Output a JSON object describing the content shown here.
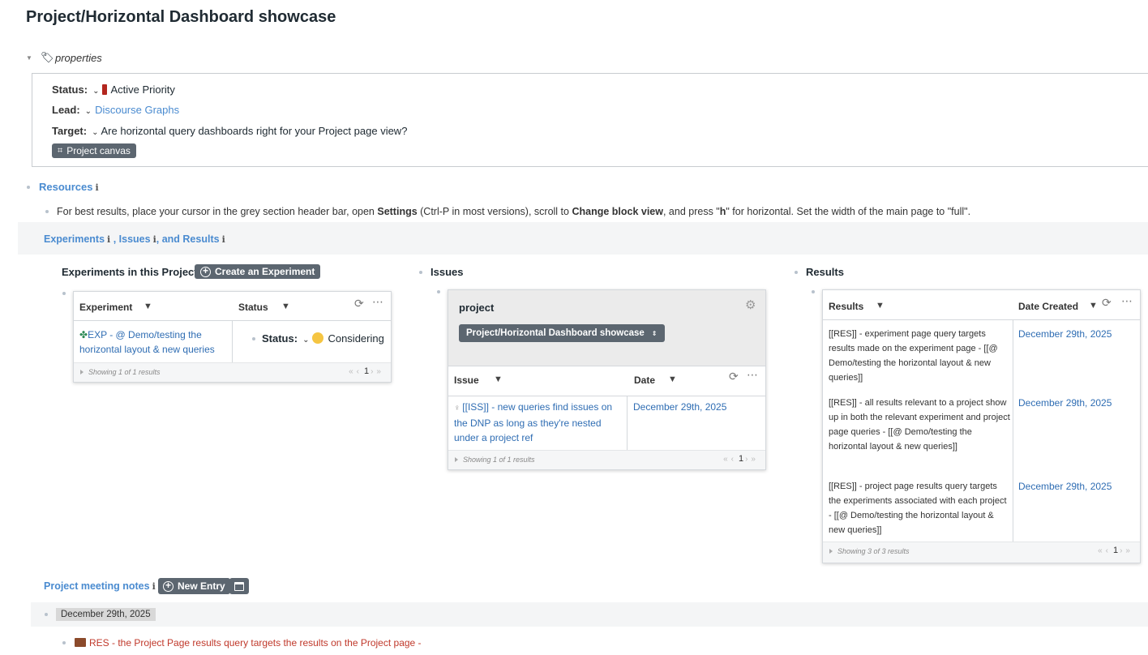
{
  "page": {
    "title": "Project/Horizontal Dashboard showcase"
  },
  "properties": {
    "label": "properties",
    "status_label": "Status:",
    "status_value": "Active Priority",
    "lead_label": "Lead:",
    "lead_value": "Discourse Graphs",
    "target_label": "Target:",
    "target_value": "Are horizontal query dashboards right for your Project page view?",
    "canvas_button": "Project canvas"
  },
  "resources": {
    "label": "Resources",
    "info": "i",
    "tip_prefix": "For best results, place your cursor in the grey section header bar, open ",
    "tip_settings": "Settings",
    "tip_mid": " (Ctrl-P in most versions), scroll to ",
    "tip_change": "Change block view",
    "tip_mid2": ", and press \"",
    "tip_h": "h",
    "tip_suffix": "\" for horizontal. Set the width of the main page to \"full\"."
  },
  "section_header": {
    "experiments": "Experiments",
    "sep1": " , ",
    "issues": "Issues",
    "sep2": ", ",
    "and_results": "and Results",
    "info": "i"
  },
  "experiments": {
    "title": "Experiments in this Project",
    "create_button": "Create an Experiment",
    "columns": [
      "Experiment",
      "Status"
    ],
    "rows": [
      {
        "experiment": "EXP - @ Demo/testing the horizontal layout & new queries",
        "status_label": "Status:",
        "status_value": "Considering"
      }
    ],
    "showing": "Showing 1 of 1 results",
    "page": "1"
  },
  "issues": {
    "title": "Issues",
    "panel_title": "project",
    "panel_select": "Project/Horizontal Dashboard showcase",
    "columns": [
      "Issue",
      "Date"
    ],
    "rows": [
      {
        "issue": "[[ISS]] - new queries find issues on the DNP as long as they're nested under a project ref",
        "date": "December 29th, 2025"
      }
    ],
    "showing": "Showing 1 of 1 results",
    "page": "1"
  },
  "results": {
    "title": "Results",
    "columns": [
      "Results",
      "Date Created"
    ],
    "rows": [
      {
        "result": "[[RES]] - experiment page query targets results made on the experiment page - [[@ Demo/testing the horizontal layout & new queries]]",
        "date": "December 29th, 2025"
      },
      {
        "result": "[[RES]] - all results relevant to a project show up in both the relevant experiment and project page queries  - [[@ Demo/testing the horizontal layout & new queries]]",
        "date": "December 29th, 2025"
      },
      {
        "result": "[[RES]] - project page results query targets the experiments associated with each project - [[@ Demo/testing the horizontal layout & new queries]]",
        "date": "December 29th, 2025"
      }
    ],
    "showing": "Showing 3 of 3 results",
    "page": "1"
  },
  "meeting_notes": {
    "label": "Project meeting notes",
    "info": "i",
    "new_entry": "New Entry",
    "date_tag": "December 29th, 2025",
    "res_line": "RES -  the Project Page results query targets the results on the Project page -"
  }
}
